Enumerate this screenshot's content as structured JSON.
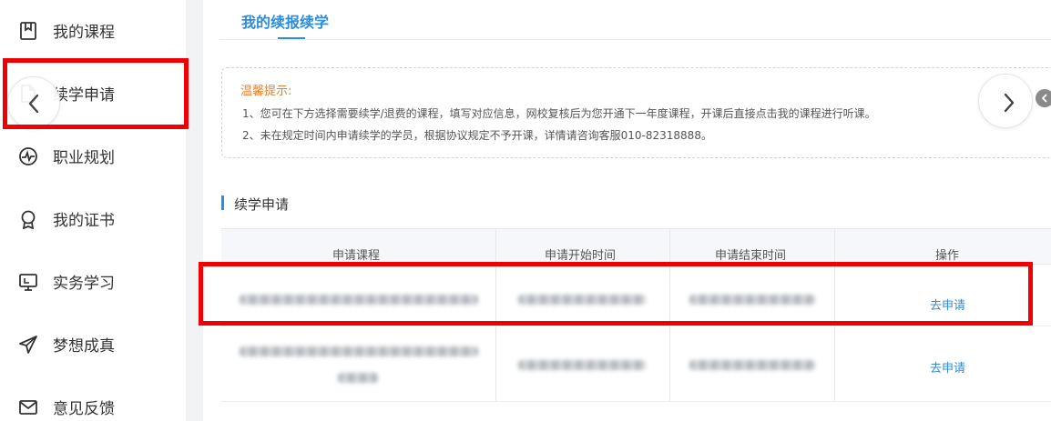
{
  "sidebar": {
    "items": [
      {
        "label": "我的课程",
        "icon": "bookmark-icon"
      },
      {
        "label": "续学申请",
        "icon": "document-icon"
      },
      {
        "label": "职业规划",
        "icon": "pulse-icon"
      },
      {
        "label": "我的证书",
        "icon": "award-icon"
      },
      {
        "label": "实务学习",
        "icon": "monitor-icon"
      },
      {
        "label": "梦想成真",
        "icon": "paper-plane-icon"
      },
      {
        "label": "意见反馈",
        "icon": "mail-icon"
      }
    ]
  },
  "main": {
    "tab_title": "我的续报续学",
    "notice": {
      "title": "温馨提示:",
      "lines": [
        "1、您可在下方选择需要续学/退费的课程，填写对应信息，网校复核后为您开通下一年度课程，开课后直接点击我的课程进行听课。",
        "2、未在规定时间内申请续学的学员，根据协议规定不予开课，详情请咨询客服010-82318888。"
      ]
    },
    "section_title": "续学申请",
    "table": {
      "headers": [
        "申请课程",
        "申请开始时间",
        "申请结束时间",
        "操作"
      ],
      "rows": [
        {
          "action": "去申请"
        },
        {
          "action": "去申请"
        }
      ]
    }
  },
  "colors": {
    "accent": "#2e8cd8",
    "notice_title": "#e9802c",
    "highlight_box": "#f00000"
  }
}
